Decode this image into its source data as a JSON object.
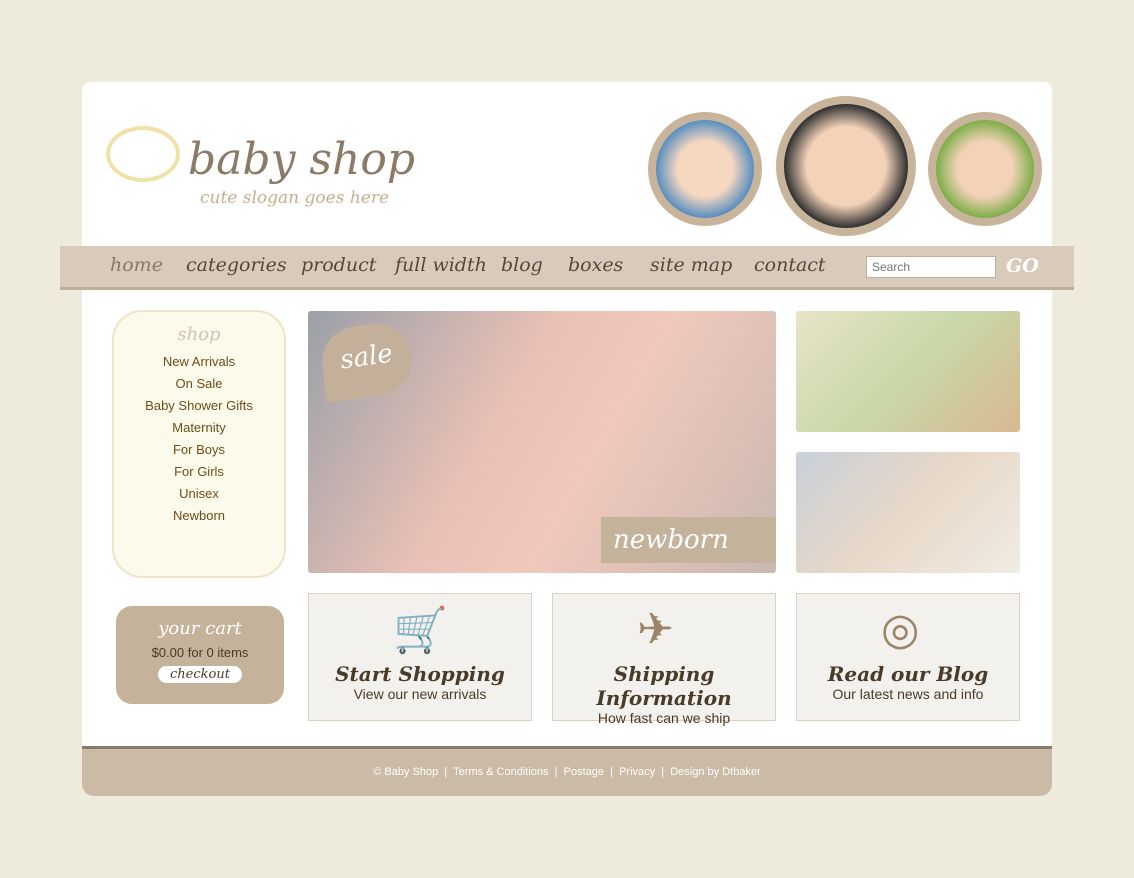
{
  "header": {
    "title": "baby shop",
    "slogan": "cute slogan goes here"
  },
  "nav": {
    "items": [
      "home",
      "categories",
      "product",
      "full width",
      "blog",
      "boxes",
      "site map",
      "contact"
    ],
    "search_placeholder": "Search",
    "go_label": "GO"
  },
  "shop": {
    "title": "shop",
    "items": [
      "New Arrivals",
      "On Sale",
      "Baby Shower Gifts",
      "Maternity",
      "For Boys",
      "For Girls",
      "Unisex",
      "Newborn"
    ]
  },
  "cart": {
    "title": "your cart",
    "summary": "$0.00 for 0 items",
    "checkout": "checkout"
  },
  "hero": {
    "badge": "sale",
    "caption": "newborn"
  },
  "boxes": [
    {
      "title": "Start Shopping",
      "subtitle": "View our new arrivals",
      "icon": "cart-icon"
    },
    {
      "title": "Shipping Information",
      "subtitle": "How fast can we ship",
      "icon": "stork-icon"
    },
    {
      "title": "Read our Blog",
      "subtitle": "Our latest news and info",
      "icon": "pacifier-icon"
    }
  ],
  "footer": {
    "copyright": "© Baby Shop",
    "links": [
      "Terms & Conditions",
      "Postage",
      "Privacy",
      "Design by Dtbaker"
    ]
  },
  "colors": {
    "accent": "#c4b29a",
    "text": "#5b4632",
    "background": "#efebdc"
  }
}
